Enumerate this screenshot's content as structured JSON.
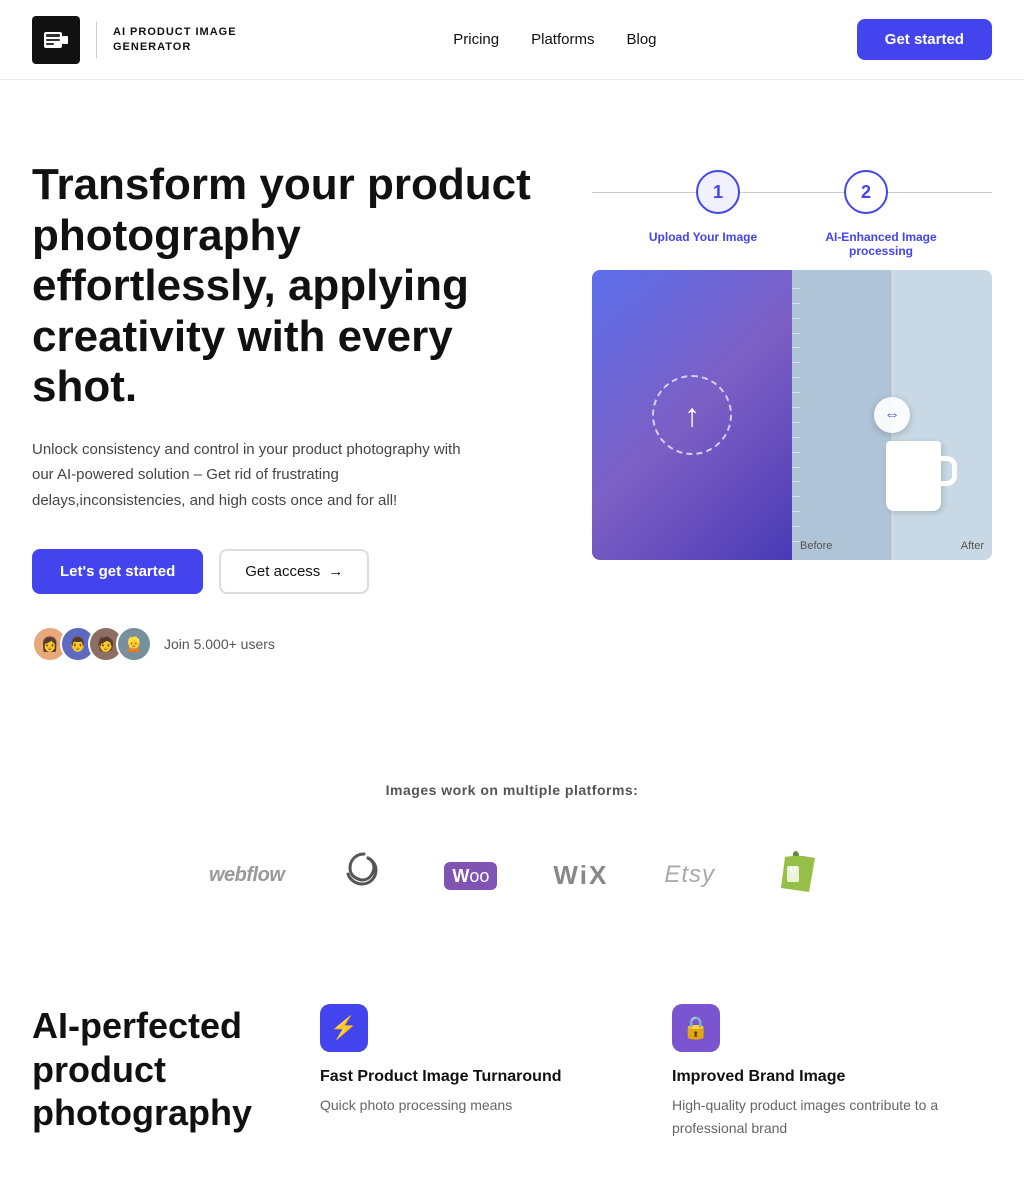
{
  "nav": {
    "logo_text": "AI PRODUCT IMAGE GENERATOR",
    "links": [
      {
        "id": "pricing",
        "label": "Pricing"
      },
      {
        "id": "platforms",
        "label": "Platforms"
      },
      {
        "id": "blog",
        "label": "Blog"
      }
    ],
    "cta_label": "Get started"
  },
  "hero": {
    "title": "Transform your product photography effortlessly, applying creativity with every shot.",
    "subtitle": "Unlock consistency and control in your product photography with our AI-powered solution – Get rid of frustrating delays,inconsistencies, and high costs once and for all!",
    "btn_primary": "Let's get started",
    "btn_secondary": "Get access",
    "social_text": "Join 5.000+ users",
    "step1": {
      "number": "1",
      "label": "Upload Your Image"
    },
    "step2": {
      "number": "2",
      "label": "AI-Enhanced Image processing"
    },
    "before_label": "Before",
    "after_label": "After"
  },
  "platforms": {
    "title": "Images work on multiple platforms:",
    "logos": [
      {
        "id": "webflow",
        "label": "webflow"
      },
      {
        "id": "squarespace",
        "label": "◈"
      },
      {
        "id": "woo",
        "label": "Woo"
      },
      {
        "id": "wix",
        "label": "Wix"
      },
      {
        "id": "etsy",
        "label": "Etsy"
      },
      {
        "id": "shopify",
        "label": "🛍"
      }
    ]
  },
  "features": {
    "section_title": "AI-perfected product photography",
    "cards": [
      {
        "id": "fast-turnaround",
        "icon": "⚡",
        "icon_style": "blue",
        "title": "Fast Product Image Turnaround",
        "desc": "Quick photo processing means"
      },
      {
        "id": "brand-image",
        "icon": "🔒",
        "icon_style": "purple",
        "title": "Improved Brand Image",
        "desc": "High-quality product images contribute to a professional brand"
      }
    ]
  }
}
